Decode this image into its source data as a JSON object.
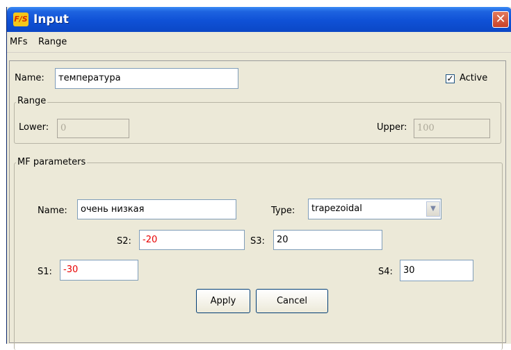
{
  "window": {
    "title": "Input",
    "app_icon_text": "F/S",
    "close_glyph": "✕"
  },
  "menu": {
    "items": [
      "MFs",
      "Range"
    ]
  },
  "variable": {
    "name_label": "Name:",
    "name_value": "температура",
    "active_label": "Active",
    "active_checked": true
  },
  "range": {
    "group_title": "Range",
    "lower_label": "Lower:",
    "lower_value": "0",
    "upper_label": "Upper:",
    "upper_value": "100"
  },
  "mf": {
    "group_title": "MF parameters",
    "name_label": "Name:",
    "name_value": "очень низкая",
    "type_label": "Type:",
    "type_value": "trapezoidal",
    "s1_label": "S1:",
    "s1_value": "-30",
    "s2_label": "S2:",
    "s2_value": "-20",
    "s3_label": "S3:",
    "s3_value": "20",
    "s4_label": "S4:",
    "s4_value": "30"
  },
  "buttons": {
    "apply": "Apply",
    "cancel": "Cancel"
  },
  "colors": {
    "titlebar": "#0f51d6",
    "negative_value": "#e80000",
    "dialog_bg": "#ece9d8"
  }
}
